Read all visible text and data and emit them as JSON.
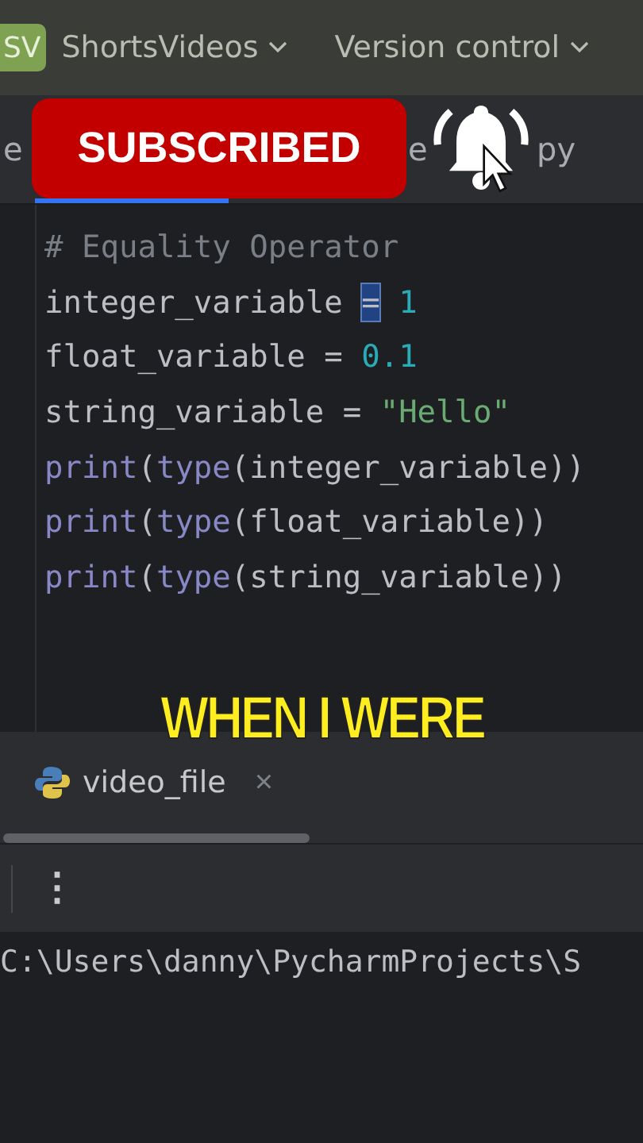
{
  "header": {
    "project_badge": "SV",
    "project": "ShortsVideos",
    "vcs": "Version control"
  },
  "tab_bar": {
    "fragments": [
      "e",
      "e",
      "py"
    ]
  },
  "overlay": {
    "button": "SUBSCRIBED"
  },
  "editor": {
    "lines": [
      [
        {
          "text": "# Equality Operator",
          "kind": "comment"
        }
      ],
      [
        {
          "text": "integer_variable ",
          "kind": "plain"
        },
        {
          "text": "=",
          "kind": "cursor"
        },
        {
          "text": " 1",
          "kind": "number"
        }
      ],
      [
        {
          "text": "float_variable = ",
          "kind": "plain"
        },
        {
          "text": "0.1",
          "kind": "number"
        }
      ],
      [
        {
          "text": "string_variable = ",
          "kind": "plain"
        },
        {
          "text": "\"Hello\"",
          "kind": "string"
        }
      ],
      [
        {
          "text": "print",
          "kind": "builtin"
        },
        {
          "text": "(",
          "kind": "plain"
        },
        {
          "text": "type",
          "kind": "builtin"
        },
        {
          "text": "(integer_variable))",
          "kind": "plain"
        }
      ],
      [
        {
          "text": "print",
          "kind": "builtin"
        },
        {
          "text": "(",
          "kind": "plain"
        },
        {
          "text": "type",
          "kind": "builtin"
        },
        {
          "text": "(float_variable))",
          "kind": "plain"
        }
      ],
      [
        {
          "text": "print",
          "kind": "builtin"
        },
        {
          "text": "(",
          "kind": "plain"
        },
        {
          "text": "type",
          "kind": "builtin"
        },
        {
          "text": "(string_variable))",
          "kind": "plain"
        }
      ]
    ]
  },
  "caption": "WHEN I WERE",
  "run_panel": {
    "tab": "video_file",
    "close": "×",
    "menu": "⋮",
    "output": "C:\\Users\\danny\\PycharmProjects\\S"
  }
}
